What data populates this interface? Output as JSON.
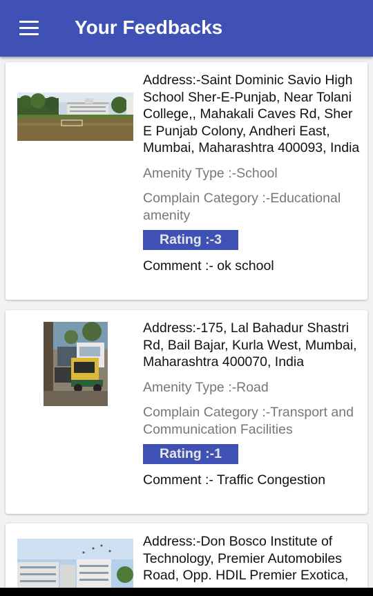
{
  "header": {
    "title": "Your Feedbacks",
    "menu_icon": "hamburger-menu-icon"
  },
  "feedbacks": [
    {
      "address": "Address:-Saint Dominic Savio High School Sher-E-Punjab, Near Tolani College,, Mahakali Caves Rd, Sher E Punjab Colony, Andheri East, Mumbai, Maharashtra 400093, India",
      "amenity": "Amenity Type :-School",
      "category": "Complain Category :-Educational amenity",
      "rating": "Rating :-3",
      "comment": "Comment :- ok school"
    },
    {
      "address": "Address:-175, Lal Bahadur Shastri Rd, Bail Bajar, Kurla West, Mumbai, Maharashtra 400070, India",
      "amenity": "Amenity Type :-Road",
      "category": "Complain Category :-Transport and Communication Facilities",
      "rating": "Rating :-1",
      "comment": "Comment :- Traffic Congestion"
    },
    {
      "address": "Address:-Don Bosco Institute of Technology, Premier Automobiles Road, Opp. HDIL Premier Exotica,"
    }
  ],
  "colors": {
    "primary": "#3f51b5",
    "background": "#f2f2f2",
    "secondary_text": "#777777"
  }
}
